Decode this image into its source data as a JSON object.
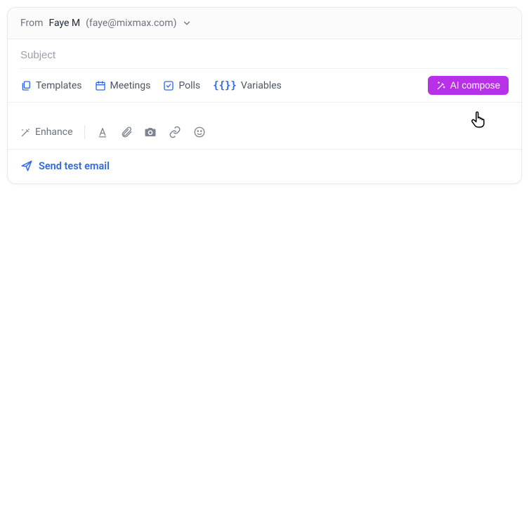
{
  "from": {
    "label": "From",
    "name": "Faye M",
    "email": "(faye@mixmax.com)"
  },
  "subject": {
    "placeholder": "Subject",
    "value": ""
  },
  "toolbar": {
    "items": {
      "templates": "Templates",
      "meetings": "Meetings",
      "polls": "Polls",
      "variables": "Variables"
    },
    "ai_compose": "AI compose"
  },
  "bottom": {
    "enhance": "Enhance"
  },
  "footer": {
    "send_test": "Send test email"
  }
}
